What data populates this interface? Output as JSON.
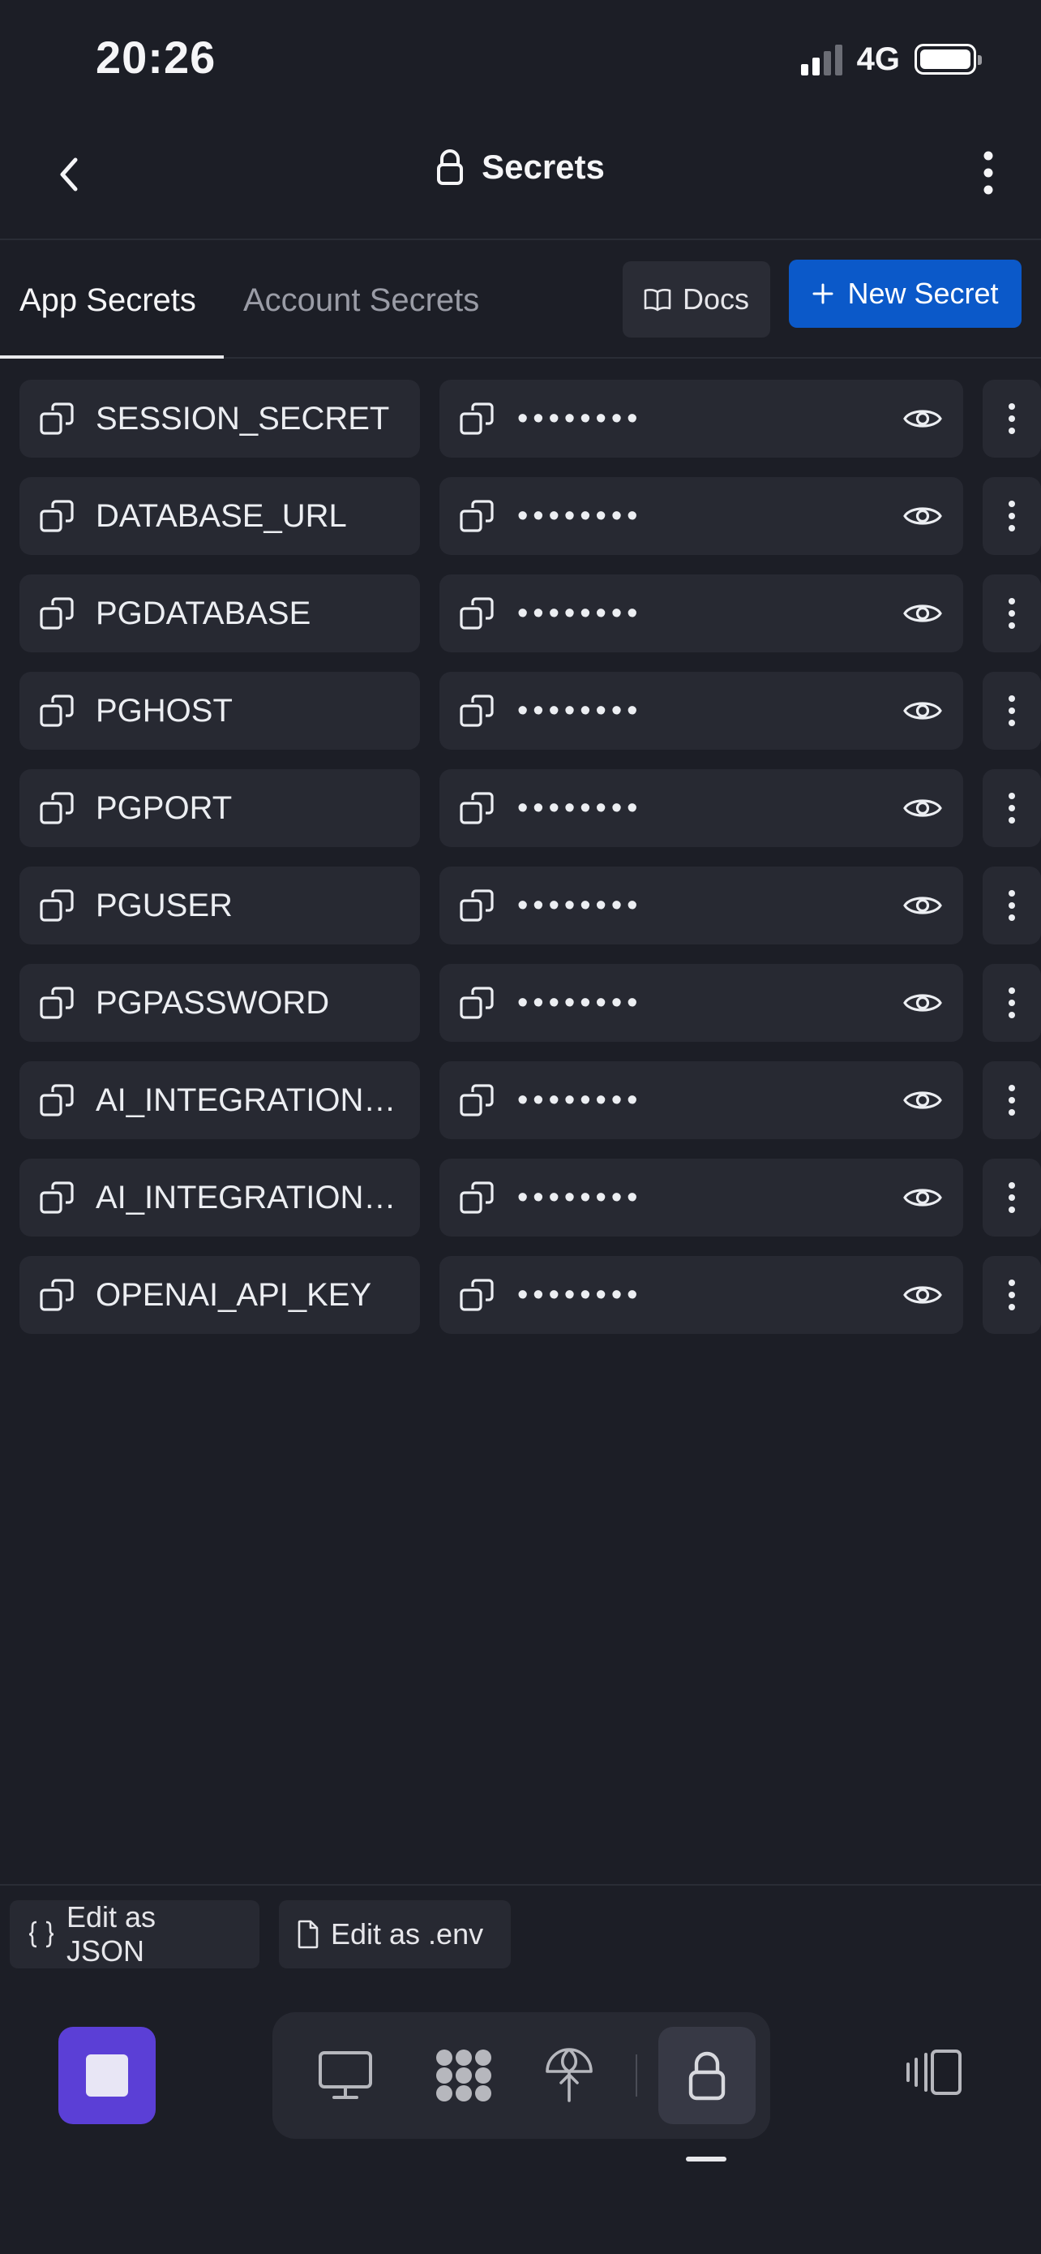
{
  "status_bar": {
    "time": "20:26",
    "network": "4G"
  },
  "header": {
    "title": "Secrets"
  },
  "tabs": [
    {
      "label": "App Secrets",
      "active": true
    },
    {
      "label": "Account Secrets",
      "active": false
    }
  ],
  "actions": {
    "docs_label": "Docs",
    "new_secret_label": "New Secret"
  },
  "secrets": [
    {
      "key": "SESSION_SECRET",
      "value": "••••••••"
    },
    {
      "key": "DATABASE_URL",
      "value": "••••••••"
    },
    {
      "key": "PGDATABASE",
      "value": "••••••••"
    },
    {
      "key": "PGHOST",
      "value": "••••••••"
    },
    {
      "key": "PGPORT",
      "value": "••••••••"
    },
    {
      "key": "PGUSER",
      "value": "••••••••"
    },
    {
      "key": "PGPASSWORD",
      "value": "••••••••"
    },
    {
      "key": "AI_INTEGRATION…",
      "value": "••••••••"
    },
    {
      "key": "AI_INTEGRATION…",
      "value": "••••••••"
    },
    {
      "key": "OPENAI_API_KEY",
      "value": "••••••••"
    }
  ],
  "editor": {
    "json_label": "Edit as JSON",
    "env_label": "Edit as .env"
  },
  "toolbar": {
    "tools": [
      "monitor-icon",
      "workspace-icon",
      "deploy-icon",
      "lock-icon"
    ],
    "active_tool": "lock-icon"
  },
  "colors": {
    "background": "#1c1e26",
    "cell": "#272932",
    "accent": "#0b59c9",
    "stop": "#5b3fd6"
  }
}
